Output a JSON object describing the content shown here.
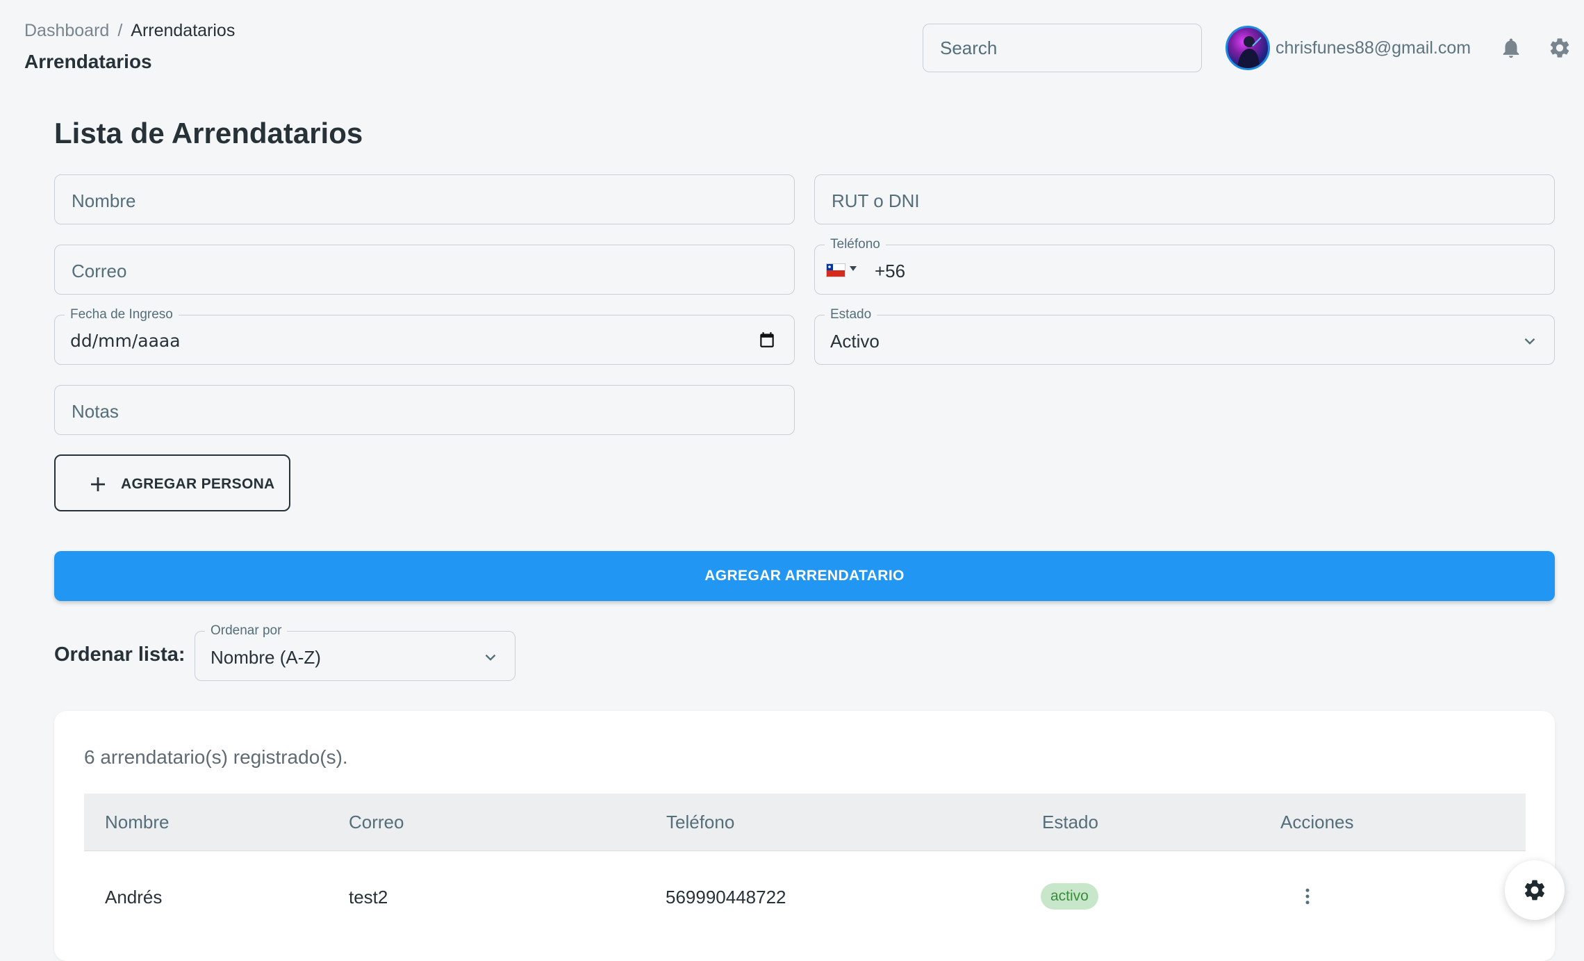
{
  "header": {
    "breadcrumb": {
      "root": "Dashboard",
      "separator": "/",
      "current": "Arrendatarios"
    },
    "page_subtitle": "Arrendatarios",
    "search_placeholder": "Search",
    "user_email": "chrisfunes88@gmail.com",
    "icons": {
      "notifications": "bell-icon",
      "settings": "gear-icon"
    }
  },
  "form": {
    "title": "Lista de Arrendatarios",
    "nombre_placeholder": "Nombre",
    "rut_placeholder": "RUT o DNI",
    "correo_placeholder": "Correo",
    "telefono_label": "Teléfono",
    "telefono_value": "+56",
    "telefono_country": "Chile",
    "fecha_label": "Fecha de Ingreso",
    "fecha_value": "dd/mm/aaaa",
    "estado_label": "Estado",
    "estado_value": "Activo",
    "notas_placeholder": "Notas",
    "add_person_label": "AGREGAR PERSONA",
    "submit_label": "AGREGAR ARRENDATARIO"
  },
  "sort": {
    "label": "Ordenar lista:",
    "field_label": "Ordenar por",
    "value": "Nombre (A-Z)"
  },
  "table": {
    "count_text": "6 arrendatario(s) registrado(s).",
    "columns": [
      "Nombre",
      "Correo",
      "Teléfono",
      "Estado",
      "Acciones"
    ],
    "rows": [
      {
        "nombre": "Andrés",
        "correo": "test2",
        "telefono": "569990448722",
        "estado": "activo"
      }
    ]
  },
  "colors": {
    "primary": "#2196f3",
    "background": "#f5f6f8",
    "badge_active_bg": "#c8e6c9",
    "badge_active_text": "#388e3c"
  }
}
